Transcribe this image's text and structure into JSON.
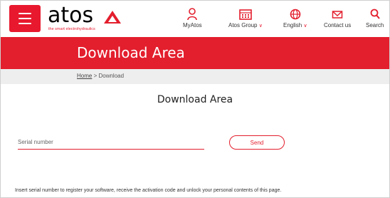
{
  "logo": {
    "word": "atos",
    "tagline": "the smart electrohydraulics"
  },
  "nav": {
    "items": [
      {
        "label": "MyAtos",
        "icon": "user-icon"
      },
      {
        "label": "Atos Group",
        "icon": "building-icon",
        "dropdown": true
      },
      {
        "label": "English",
        "icon": "globe-icon",
        "dropdown": true
      },
      {
        "label": "Contact us",
        "icon": "mail-icon"
      },
      {
        "label": "Search",
        "icon": "search-icon"
      }
    ],
    "chevron": "∨"
  },
  "hero": {
    "title": "Download Area"
  },
  "breadcrumb": {
    "home": "Home",
    "separator": " > ",
    "current": "Download"
  },
  "main": {
    "title": "Download Area",
    "serial_placeholder": "Serial number",
    "send_label": "Send",
    "info": "Insert serial number to register your software, receive the activation code and unlock your personal contents of this page."
  },
  "colors": {
    "brand_red": "#e31e2d",
    "breadcrumb_bg": "#eeeeee"
  }
}
